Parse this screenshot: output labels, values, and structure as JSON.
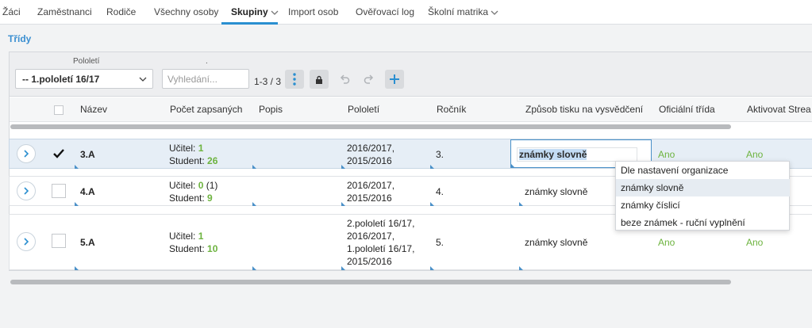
{
  "nav": {
    "items": [
      {
        "label": "Žáci"
      },
      {
        "label": "Zaměstnanci"
      },
      {
        "label": "Rodiče"
      },
      {
        "label": "Všechny osoby"
      },
      {
        "label": "Skupiny"
      },
      {
        "label": "Import osob"
      },
      {
        "label": "Ověřovací log"
      },
      {
        "label": "Školní matrika"
      }
    ],
    "active": "Skupiny",
    "accent_color": "#2a8fd0"
  },
  "section_title": "Třídy",
  "toolbar": {
    "semester_label": "Pololetí",
    "search_label": ".",
    "semester_value": "-- 1.pololetí 16/17",
    "search_placeholder": "Vyhledání...",
    "counter": "1-3 / 3",
    "icons": [
      "more-vertical-icon",
      "lock-icon",
      "undo-icon",
      "redo-icon",
      "plus-icon"
    ]
  },
  "columns": [
    "Název",
    "Počet zapsaných",
    "Popis",
    "Pololetí",
    "Ročník",
    "Způsob tisku na vysvědčení",
    "Oficiální třída",
    "Aktivovat Strea"
  ],
  "rows": [
    {
      "name": "3.A",
      "checked": true,
      "teacher_label": "Učitel:",
      "teacher_count": "1",
      "teacher_extra": "",
      "student_label": "Student:",
      "student_count": "26",
      "semester_lines": [
        "2016/2017,",
        "2015/2016"
      ],
      "year": "3.",
      "print_mode": "známky slovně",
      "official": "Ano",
      "activate": "Ano"
    },
    {
      "name": "4.A",
      "checked": false,
      "teacher_label": "Učitel:",
      "teacher_count": "0",
      "teacher_extra": "(1)",
      "student_label": "Student:",
      "student_count": "9",
      "semester_lines": [
        "2016/2017,",
        "2015/2016"
      ],
      "year": "4.",
      "print_mode": "známky slovně",
      "official": "",
      "activate": ""
    },
    {
      "name": "5.A",
      "checked": false,
      "teacher_label": "Učitel:",
      "teacher_count": "1",
      "teacher_extra": "",
      "student_label": "Student:",
      "student_count": "10",
      "semester_lines": [
        "2.pololetí 16/17,",
        "2016/2017,",
        "1.pololetí 16/17,",
        "2015/2016"
      ],
      "year": "5.",
      "print_mode": "známky slovně",
      "official": "Ano",
      "activate": "Ano"
    }
  ],
  "dropdown": {
    "options": [
      "Dle nastavení organizace",
      "známky slovně",
      "známky číslicí",
      "beze známek - ruční vyplnění"
    ],
    "highlighted": "známky slovně"
  },
  "colors": {
    "green": "#6db33f",
    "blue": "#4a90c8",
    "selected_row": "#e6eef6"
  }
}
